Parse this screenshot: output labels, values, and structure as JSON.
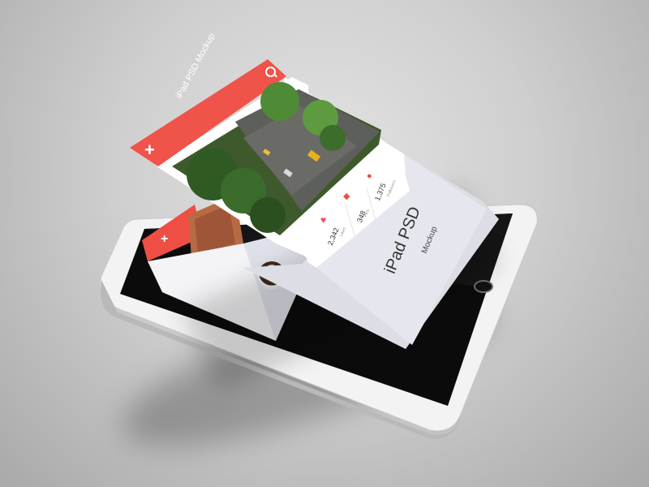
{
  "app": {
    "title": "iPad PSD Mockup",
    "accent": "#EE4E44"
  },
  "toolbar": {
    "add_icon": "plus-icon",
    "add_glyph": "+",
    "search_icon": "search-icon"
  },
  "stats": [
    {
      "value": "2,342",
      "label": "Likes",
      "icon": "heart-icon",
      "glyph": "♥"
    },
    {
      "value": "348",
      "label": "Pins",
      "icon": "pin-icon",
      "glyph": "◆"
    },
    {
      "value": "1,375",
      "label": "Followers",
      "icon": "user-icon",
      "glyph": "●"
    }
  ],
  "hero": {
    "title": "iPad PSD",
    "subtitle": "Mockup"
  },
  "screen": {
    "add_glyph": "+"
  }
}
